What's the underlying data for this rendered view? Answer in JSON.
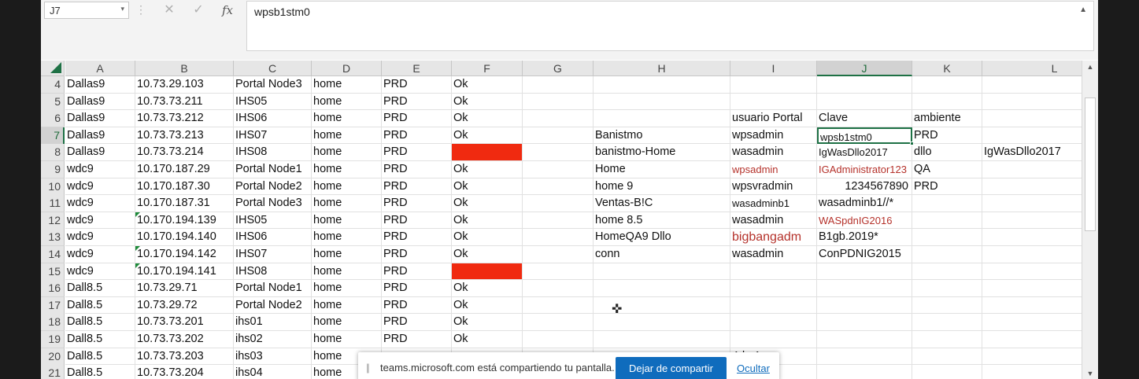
{
  "formula_bar": {
    "name_box": "J7",
    "cancel_icon": "✕",
    "enter_icon": "✓",
    "fx_label": "fx",
    "formula": "wpsb1stm0"
  },
  "columns": [
    "A",
    "B",
    "C",
    "D",
    "E",
    "F",
    "G",
    "H",
    "I",
    "J",
    "K",
    "L"
  ],
  "selected_column": "J",
  "selected_row": "7",
  "rows": [
    {
      "n": "4",
      "A": "Dallas9",
      "B": "10.73.29.103",
      "C": "Portal Node3",
      "D": "home",
      "E": "PRD",
      "F": "Ok"
    },
    {
      "n": "5",
      "A": "Dallas9",
      "B": "10.73.73.211",
      "C": "IHS05",
      "D": "home",
      "E": "PRD",
      "F": "Ok"
    },
    {
      "n": "6",
      "A": "Dallas9",
      "B": "10.73.73.212",
      "C": "IHS06",
      "D": "home",
      "E": "PRD",
      "F": "Ok",
      "I": "usuario Portal",
      "J": "Clave",
      "K": "ambiente"
    },
    {
      "n": "7",
      "A": "Dallas9",
      "B": "10.73.73.213",
      "C": "IHS07",
      "D": "home",
      "E": "PRD",
      "F": "Ok",
      "H": "Banistmo",
      "I": "wpsadmin",
      "J": "wpsb1stm0",
      "K": "PRD"
    },
    {
      "n": "8",
      "A": "Dallas9",
      "B": "10.73.73.214",
      "C": "IHS08",
      "D": "home",
      "E": "PRD",
      "F": "",
      "H": "banistmo-Home",
      "I": "wasadmin",
      "J": "IgWasDllo2017",
      "K": "dllo",
      "L": "IgWasDllo2017"
    },
    {
      "n": "9",
      "A": "wdc9",
      "B": "10.170.187.29",
      "C": "Portal Node1",
      "D": "home",
      "E": "PRD",
      "F": "Ok",
      "H": "Home",
      "I": "wpsadmin",
      "J": "IGAdministrator123",
      "K": "QA"
    },
    {
      "n": "10",
      "A": "wdc9",
      "B": "10.170.187.30",
      "C": "Portal Node2",
      "D": "home",
      "E": "PRD",
      "F": "Ok",
      "H": "home 9",
      "I": "wpsvradmin",
      "J": "1234567890",
      "K": "PRD"
    },
    {
      "n": "11",
      "A": "wdc9",
      "B": "10.170.187.31",
      "C": "Portal Node3",
      "D": "home",
      "E": "PRD",
      "F": "Ok",
      "H": "Ventas-B!C",
      "I": "wasadminb1",
      "J": "wasadminb1//*"
    },
    {
      "n": "12",
      "A": "wdc9",
      "B": "10.170.194.139",
      "C": "IHS05",
      "D": "home",
      "E": "PRD",
      "F": "Ok",
      "H": "home 8.5",
      "I": "wasadmin",
      "J": "WASpdnIG2016"
    },
    {
      "n": "13",
      "A": "wdc9",
      "B": "10.170.194.140",
      "C": "IHS06",
      "D": "home",
      "E": "PRD",
      "F": "Ok",
      "H": "HomeQA9 Dllo",
      "I": "bigbangadm",
      "J": "B1gb.2019*"
    },
    {
      "n": "14",
      "A": "wdc9",
      "B": "10.170.194.142",
      "C": "IHS07",
      "D": "home",
      "E": "PRD",
      "F": "Ok",
      "H": "conn",
      "I": "wasadmin",
      "J": "ConPDNIG2015"
    },
    {
      "n": "15",
      "A": "wdc9",
      "B": "10.170.194.141",
      "C": "IHS08",
      "D": "home",
      "E": "PRD",
      "F": ""
    },
    {
      "n": "16",
      "A": "Dall8.5",
      "B": "10.73.29.71",
      "C": "Portal Node1",
      "D": "home",
      "E": "PRD",
      "F": "Ok"
    },
    {
      "n": "17",
      "A": "Dall8.5",
      "B": "10.73.29.72",
      "C": "Portal Node2",
      "D": "home",
      "E": "PRD",
      "F": "Ok"
    },
    {
      "n": "18",
      "A": "Dall8.5",
      "B": "10.73.73.201",
      "C": "ihs01",
      "D": "home",
      "E": "PRD",
      "F": "Ok"
    },
    {
      "n": "19",
      "A": "Dall8.5",
      "B": "10.73.73.202",
      "C": "ihs02",
      "D": "home",
      "E": "PRD",
      "F": "Ok"
    },
    {
      "n": "20",
      "A": "Dall8.5",
      "B": "10.73.73.203",
      "C": "ihs03",
      "D": "home",
      "E": "",
      "F": "",
      "I": "4dm1n"
    },
    {
      "n": "21",
      "A": "Dall8.5",
      "B": "10.73.73.204",
      "C": "ihs04",
      "D": "home",
      "E": "",
      "F": ""
    }
  ],
  "styles": {
    "red_fill_rows": [
      "8",
      "15"
    ],
    "green_triangle_rows": [
      "12",
      "14",
      "15"
    ],
    "red_text_cells": [
      "9.I",
      "9.J",
      "12.J"
    ],
    "big_red_text_cells": [
      "13.I"
    ],
    "small_text_cells": [
      "8.J",
      "11.I",
      "7.J"
    ],
    "right_aligned_cells": [
      "10.J"
    ],
    "accent_green": "#1e7145",
    "fill_red": "#f02a10",
    "text_red": "#b5322b"
  },
  "share_banner": {
    "message": "teams.microsoft.com está compartiendo tu pantalla.",
    "stop_button": "Dejar de compartir",
    "hide_link": "Ocultar",
    "button_color": "#0f6cbd"
  }
}
